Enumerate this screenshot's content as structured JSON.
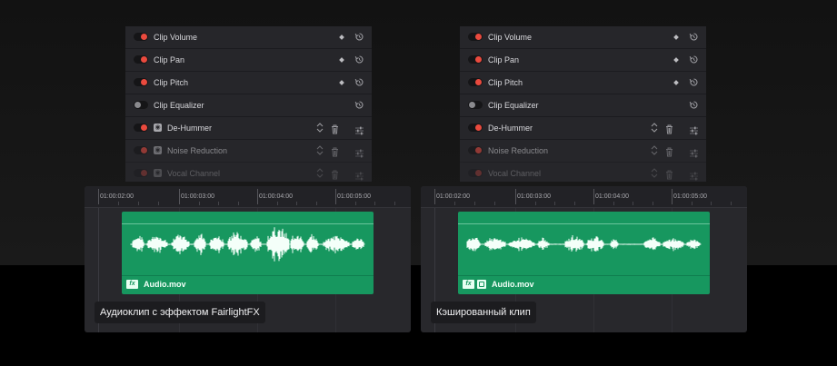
{
  "left": {
    "rows": [
      {
        "label": "Clip Volume",
        "toggle": "on"
      },
      {
        "label": "Clip Pan",
        "toggle": "on"
      },
      {
        "label": "Clip Pitch",
        "toggle": "on"
      },
      {
        "label": "Clip Equalizer",
        "toggle": "off"
      },
      {
        "label": "De-Hummer",
        "toggle": "on"
      },
      {
        "label": "Noise Reduction",
        "toggle": "on"
      },
      {
        "label": "Vocal Channel",
        "toggle": "on"
      }
    ],
    "ruler": [
      "01:00:02:00",
      "01:00:03:00",
      "01:00:04:00",
      "01:00:05:00"
    ],
    "clip_name": "Audio.mov",
    "fx_label": "fx",
    "caption": "Аудиоклип с эффектом FairlightFX"
  },
  "right": {
    "rows": [
      {
        "label": "Clip Volume",
        "toggle": "on"
      },
      {
        "label": "Clip Pan",
        "toggle": "on"
      },
      {
        "label": "Clip Pitch",
        "toggle": "on"
      },
      {
        "label": "Clip Equalizer",
        "toggle": "off"
      },
      {
        "label": "De-Hummer",
        "toggle": "on"
      },
      {
        "label": "Noise Reduction",
        "toggle": "on"
      },
      {
        "label": "Vocal Channel",
        "toggle": "on"
      }
    ],
    "ruler": [
      "01:00:02:00",
      "01:00:03:00",
      "01:00:04:00",
      "01:00:05:00"
    ],
    "clip_name": "Audio.mov",
    "fx_label": "fx",
    "caption": "Кэшированный клип"
  },
  "colors": {
    "clip": "#17975f",
    "toggle_on": "#ea4a3e",
    "toggle_off": "#8a8a8e",
    "panel": "#26262a",
    "timeline": "#28282c"
  },
  "icons": {
    "keyframe": "keyframe-diamond-icon",
    "reset": "reset-arrow-icon",
    "plugin": "plugin-icon",
    "reorder": "up-down-arrows-icon",
    "delete": "trash-icon",
    "settings": "sliders-icon",
    "fx": "fx-badge-icon",
    "cache": "cache-badge-icon"
  }
}
